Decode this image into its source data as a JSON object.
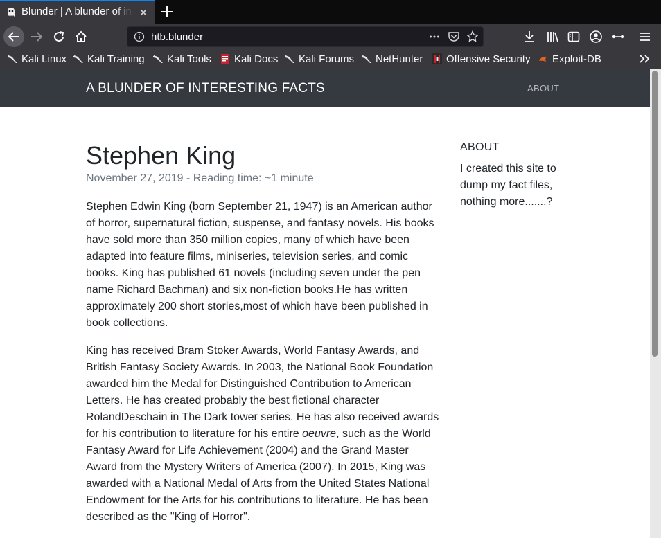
{
  "browser": {
    "tab": {
      "title": "Blunder | A blunder of interesting facts"
    },
    "url": "htb.blunder",
    "bookmarks": [
      {
        "label": "Kali Linux",
        "icon": "kali-dragon-icon"
      },
      {
        "label": "Kali Training",
        "icon": "kali-dragon-icon"
      },
      {
        "label": "Kali Tools",
        "icon": "kali-dragon-icon"
      },
      {
        "label": "Kali Docs",
        "icon": "kali-docs-icon"
      },
      {
        "label": "Kali Forums",
        "icon": "kali-dragon-icon"
      },
      {
        "label": "NetHunter",
        "icon": "kali-dragon-icon"
      },
      {
        "label": "Offensive Security",
        "icon": "offsec-icon"
      },
      {
        "label": "Exploit-DB",
        "icon": "exploitdb-icon"
      }
    ],
    "colors": {
      "chrome_dark": "#0c0c0d",
      "chrome": "#38383d",
      "accent": "#0a84ff"
    }
  },
  "site": {
    "brand": "A BLUNDER OF INTERESTING FACTS",
    "nav": {
      "about": "ABOUT"
    },
    "colors": {
      "navbar": "#343a40",
      "text": "#212529",
      "muted": "#6c757d"
    }
  },
  "post": {
    "title": "Stephen King",
    "meta": "November 27, 2019 - Reading time: ~1 minute",
    "paragraph1": "Stephen Edwin King (born September 21, 1947) is an American author of horror, supernatural fiction, suspense, and fantasy novels. His books have sold more than 350 million copies, many of which have been adapted into feature films, miniseries, television series, and comic books. King has published 61 novels (including seven under the pen name Richard Bachman) and six non-fiction books.He has written approximately 200 short stories,most of which have been published in book collections.",
    "paragraph2_before": "King has received Bram Stoker Awards, World Fantasy Awards, and British Fantasy Society Awards. In 2003, the National Book Foundation awarded him the Medal for Distinguished Contribution to American Letters. He has created probably the best fictional character RolandDeschain in The Dark tower series. He has also received awards for his contribution to literature for his entire ",
    "paragraph2_em": "oeuvre",
    "paragraph2_after": ", such as the World Fantasy Award for Life Achievement (2004) and the Grand Master Award from the Mystery Writers of America (2007). In 2015, King was awarded with a National Medal of Arts from the United States National Endowment for the Arts for his contributions to literature. He has been described as the \"King of Horror\"."
  },
  "sidebar": {
    "title": "ABOUT",
    "text": "I created this site to dump my fact files, nothing more.......?"
  }
}
